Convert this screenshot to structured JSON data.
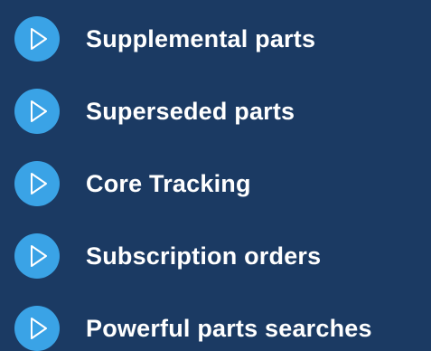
{
  "feature_list": {
    "bullet_icon": "play-triangle-outline-icon",
    "bullet_color": "#3aa3e6",
    "background_color": "#1b3a63",
    "items": [
      {
        "label": "Supplemental parts"
      },
      {
        "label": "Superseded parts"
      },
      {
        "label": "Core Tracking"
      },
      {
        "label": "Subscription orders"
      },
      {
        "label": "Powerful parts searches"
      }
    ]
  }
}
